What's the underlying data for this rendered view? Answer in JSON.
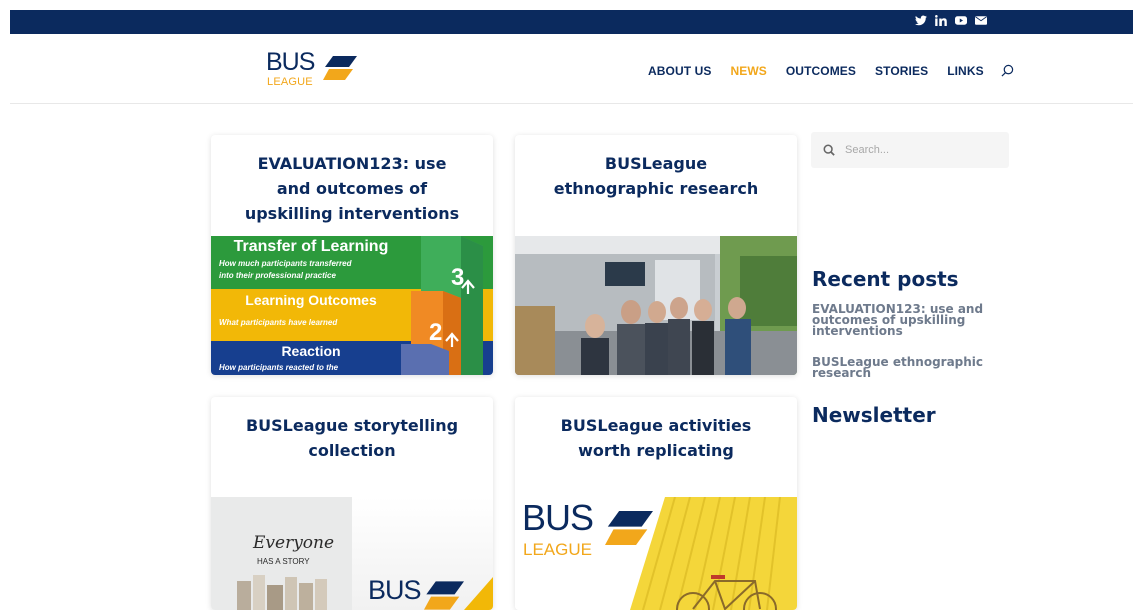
{
  "header": {
    "logo_text": "BUS",
    "logo_subtext": "LEAGUE",
    "social_icons": [
      "twitter-icon",
      "linkedin-icon",
      "youtube-icon",
      "email-icon"
    ]
  },
  "nav": {
    "items": [
      {
        "label": "ABOUT US"
      },
      {
        "label": "NEWS",
        "active": true
      },
      {
        "label": "OUTCOMES"
      },
      {
        "label": "STORIES"
      },
      {
        "label": "LINKS"
      }
    ]
  },
  "cards": [
    {
      "title": "EVALUATION123: use and outcomes of upskilling interventions",
      "image": {
        "band1_title": "Transfer of Learning",
        "band1_sub1": "How much participants transferred",
        "band1_sub2": "into their professional practice",
        "band2_title": "Learning Outcomes",
        "band2_sub": "What participants have learned",
        "band3_title": "Reaction",
        "band3_sub": "How participants reacted to the",
        "steps": [
          "3",
          "2"
        ]
      }
    },
    {
      "title": "BUSLeague ethnographic research"
    },
    {
      "title": "BUSLeague storytelling collection",
      "image": {
        "script1": "Everyone",
        "script2": "HAS A STORY",
        "logo_text": "BUS",
        "logo_subtext": "LEAGUE"
      }
    },
    {
      "title": "BUSLeague activities worth replicating",
      "image": {
        "logo_text": "BUS",
        "logo_subtext": "LEAGUE"
      }
    }
  ],
  "sidebar": {
    "search_placeholder": "Search...",
    "recent_title": "Recent posts",
    "recent_posts": [
      "EVALUATION123: use and outcomes of upskilling interventions",
      "BUSLeague ethnographic research"
    ],
    "newsletter_title": "Newsletter"
  },
  "colors": {
    "navy": "#0b2a5e",
    "accent": "#f2a71b"
  }
}
